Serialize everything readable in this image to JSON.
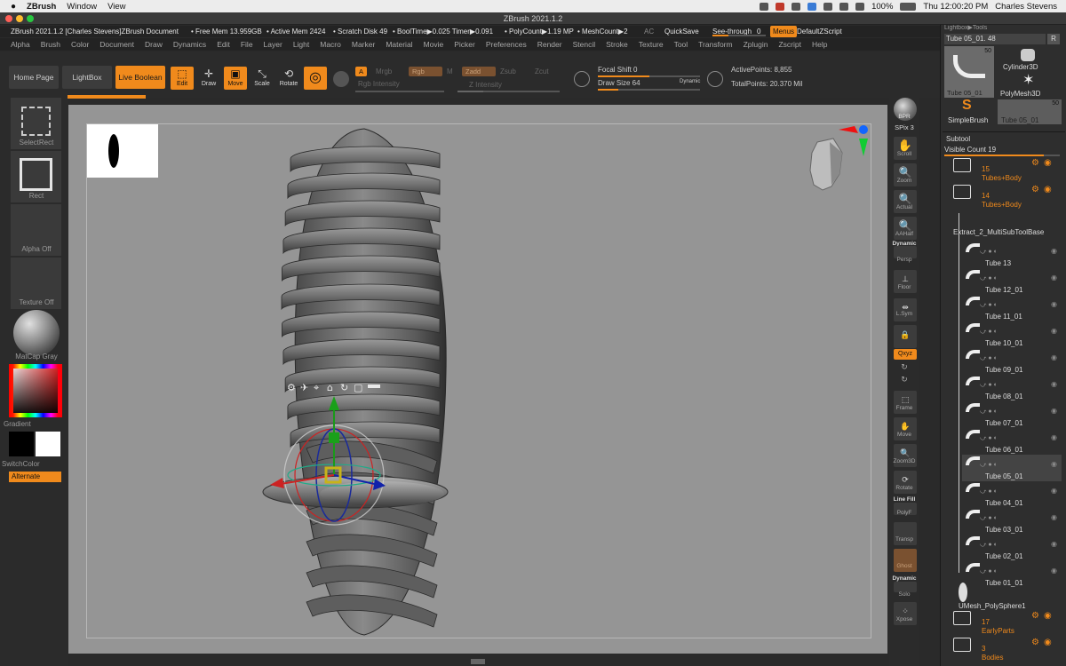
{
  "mac_menu": {
    "apple": "",
    "app": "ZBrush",
    "items": [
      "Window",
      "View"
    ],
    "battery": "100%",
    "clock": "Thu 12:00:20 PM",
    "user": "Charles Stevens"
  },
  "window_title": "ZBrush 2021.1.2",
  "info_bar": {
    "doc": "ZBrush 2021.1.2 [Charles Stevens]ZBrush Document",
    "free_mem": "• Free Mem 13.959GB",
    "active_mem": "• Active Mem 2424",
    "scratch": "• Scratch Disk 49",
    "bool": "• BoolTime▶0.025 Timer▶0.091",
    "poly": "• PolyCount▶1.19 MP",
    "mesh": "• MeshCount▶2",
    "ac": "AC",
    "quicksave": "QuickSave",
    "seethrough": "See-through",
    "seethrough_val": "0",
    "menus": "Menus",
    "script": "DefaultZScript"
  },
  "main_menu": [
    "Alpha",
    "Brush",
    "Color",
    "Document",
    "Draw",
    "Dynamics",
    "Edit",
    "File",
    "Layer",
    "Light",
    "Macro",
    "Marker",
    "Material",
    "Movie",
    "Picker",
    "Preferences",
    "Render",
    "Stencil",
    "Stroke",
    "Texture",
    "Tool",
    "Transform",
    "Zplugin",
    "Zscript",
    "Help"
  ],
  "shelf": {
    "home": "Home Page",
    "lightbox": "LightBox",
    "live_boolean": "Live Boolean",
    "edit": "Edit",
    "draw": "Draw",
    "move": "Move",
    "scale": "Scale",
    "rotate": "Rotate",
    "a_label": "A",
    "mrgb": "Mrgb",
    "rgb": "Rgb",
    "m": "M",
    "zadd": "Zadd",
    "zsub": "Zsub",
    "zcut": "Zcut",
    "rgb_intensity": "Rgb Intensity",
    "z_intensity": "Z Intensity",
    "focal_shift": "Focal Shift 0",
    "draw_size": "Draw Size 64",
    "dynamic": "Dynamic",
    "active_points": "ActivePoints: 8,855",
    "total_points": "TotalPoints: 20.370 Mil",
    "rgb_intensity_level": 1.0,
    "z_intensity_level": 0.25,
    "focal_shift_level": 0.5,
    "draw_size_level": 0.2
  },
  "left_tray": {
    "selectrect": "SelectRect",
    "rect": "Rect",
    "alpha": "Alpha Off",
    "texture": "Texture Off",
    "matcap": "MatCap Gray",
    "gradient": "Gradient",
    "switchcolor": "SwitchColor",
    "alternate": "Alternate"
  },
  "right_strip": {
    "bpr": "BPR",
    "spix": "SPix 3",
    "scroll": "Scroll",
    "zoom": "Zoom",
    "actual": "Actual",
    "aahalf": "AAHalf",
    "dynamic": "Dynamic",
    "persp": "Persp",
    "floor": "Floor",
    "lsym": "L.Sym",
    "xyz": "Qxyz",
    "frame": "Frame",
    "move": "Move",
    "zoom3d": "Zoom3D",
    "rotate": "Rotate",
    "linefill": "Line Fill",
    "polyf": "PolyF",
    "transp": "Transp",
    "ghost": "Ghost",
    "solo_dyn": "Dynamic",
    "solo": "Solo",
    "xpose": "Xpose"
  },
  "right_panel": {
    "header": "Lightbox▶Tools",
    "tool_name": "Tube 05_01. 48",
    "r_label": "R",
    "thumbs": [
      {
        "label": "Tube 05_01",
        "count": "50"
      },
      {
        "label": "Cylinder3D",
        "count": ""
      },
      {
        "label": "PolyMesh3D",
        "count": ""
      },
      {
        "label": "SimpleBrush",
        "count": ""
      },
      {
        "label": "Tube 05_01",
        "count": "50"
      }
    ],
    "subtool_title": "Subtool",
    "visible_count": "Visible Count 19",
    "folders": [
      {
        "count": "15",
        "name": "Tubes+Body"
      },
      {
        "count": "14",
        "name": "Tubes+Body"
      }
    ],
    "extract": "Extract_2_MultiSubToolBase",
    "tubes": [
      "Tube 13",
      "Tube 12_01",
      "Tube 11_01",
      "Tube 10_01",
      "Tube 09_01",
      "Tube 08_01",
      "Tube 07_01",
      "Tube 06_01",
      "Tube 05_01",
      "Tube 04_01",
      "Tube 03_01",
      "Tube 02_01",
      "Tube 01_01"
    ],
    "umesh": "UMesh_PolySphere1",
    "folders_bottom": [
      {
        "count": "17",
        "name": "EarlyParts"
      },
      {
        "count": "3",
        "name": "Bodies"
      }
    ]
  },
  "colors": {
    "accent": "#f08a1c",
    "canvas": "#959595",
    "ui_dark": "#2b2b2b"
  }
}
